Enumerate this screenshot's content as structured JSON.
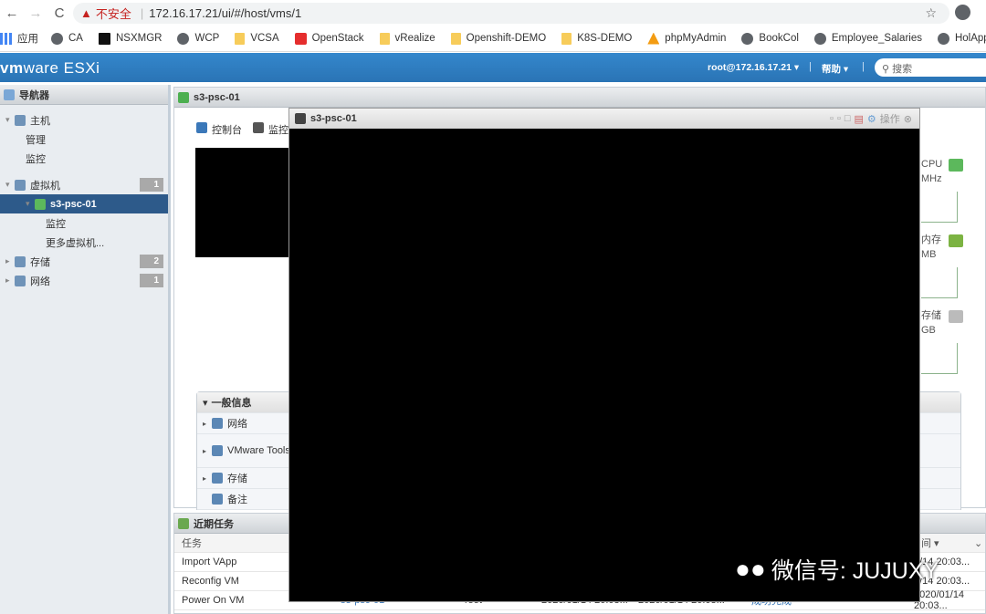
{
  "browser": {
    "insecure_label": "不安全",
    "url": "172.16.17.21/ui/#/host/vms/1",
    "bookmarks": [
      {
        "label": "应用",
        "icon": "apps-grid-icon"
      },
      {
        "label": "CA",
        "icon": "globe-icon"
      },
      {
        "label": "NSXMGR",
        "icon": "nsx-icon"
      },
      {
        "label": "WCP",
        "icon": "globe-icon"
      },
      {
        "label": "VCSA",
        "icon": "folder-icon"
      },
      {
        "label": "OpenStack",
        "icon": "openstack-icon"
      },
      {
        "label": "vRealize",
        "icon": "folder-icon"
      },
      {
        "label": "Openshift-DEMO",
        "icon": "folder-icon"
      },
      {
        "label": "K8S-DEMO",
        "icon": "folder-icon"
      },
      {
        "label": "phpMyAdmin",
        "icon": "phpmyadmin-icon"
      },
      {
        "label": "BookCol",
        "icon": "globe-icon"
      },
      {
        "label": "Employee_Salaries",
        "icon": "globe-icon"
      },
      {
        "label": "HolApp",
        "icon": "globe-icon"
      }
    ]
  },
  "header": {
    "logo_vm": "vm",
    "logo_rest": "ware ESXi",
    "user": "root@172.16.17.21 ▾",
    "help": "帮助 ▾",
    "search_placeholder": "搜索",
    "brand_color": "#2f7ec2"
  },
  "navigator": {
    "title": "导航器",
    "items": [
      {
        "label": "主机",
        "level": 0,
        "expander": "▾"
      },
      {
        "label": "管理",
        "level": 1
      },
      {
        "label": "监控",
        "level": 1
      },
      {
        "label": "虚拟机",
        "level": 0,
        "expander": "▾",
        "count": "1"
      },
      {
        "label": "s3-psc-01",
        "level": 1,
        "selected": true,
        "expander": "▾"
      },
      {
        "label": "监控",
        "level": 2
      },
      {
        "label": "更多虚拟机...",
        "level": 2
      },
      {
        "label": "存储",
        "level": 0,
        "expander": "▸",
        "count": "2"
      },
      {
        "label": "网络",
        "level": 0,
        "expander": "▸",
        "count": "1"
      }
    ]
  },
  "vm": {
    "title": "s3-psc-01",
    "toolbar": {
      "console": "控制台",
      "monitor": "监控"
    },
    "resources": [
      {
        "label": "CPU",
        "unit": "MHz"
      },
      {
        "label": "内存",
        "unit": "MB"
      },
      {
        "label": "存储",
        "unit": "GB"
      }
    ],
    "general": {
      "title": "一般信息",
      "rows": [
        "网络",
        "VMware Tools",
        "存储",
        "备注"
      ]
    }
  },
  "console": {
    "title": "s3-psc-01",
    "actions": "操作"
  },
  "tasks": {
    "title": "近期任务",
    "col_task": "任务",
    "col_time": "间 ▾",
    "rows": [
      {
        "task": "Import VApp",
        "time": "1/14 20:03..."
      },
      {
        "task": "Reconfig VM",
        "time": "1/14 20:03..."
      },
      {
        "task": "Power On VM",
        "target": "s3-psc-01",
        "user": "root",
        "queued": "2020/01/14 20:03...",
        "started": "2020/01/14 20:03...",
        "result": "成功完成",
        "time": "2020/01/14 20:03..."
      }
    ]
  },
  "watermark": "微信号: JUJUXY"
}
